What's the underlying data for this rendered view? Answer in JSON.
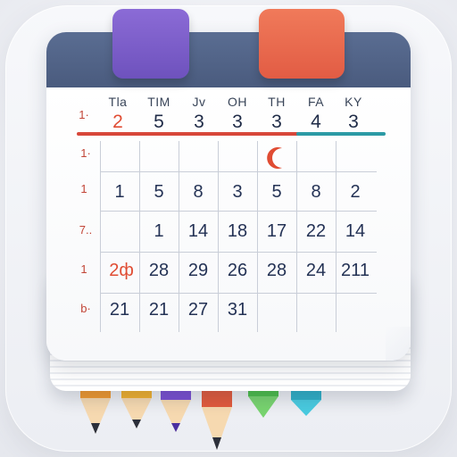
{
  "calendar": {
    "colors": {
      "header": "#4a5b7e",
      "tab_left": "#7a5bc8",
      "tab_right": "#e8674c",
      "accent_red": "#e04c33",
      "accent_teal": "#2c9aa5"
    },
    "weekday_labels": [
      "Tla",
      "TIM",
      "Jv",
      "OH",
      "TH",
      "FA",
      "KY"
    ],
    "top_dates": [
      "2",
      "5",
      "3",
      "3",
      "3",
      "4",
      "3"
    ],
    "row_labels": [
      "1·",
      "1·",
      "1",
      "7..",
      "1",
      "b·"
    ],
    "rows": [
      [
        "",
        "",
        "",
        "",
        "",
        "",
        ""
      ],
      [
        "1",
        "5",
        "8",
        "3",
        "5",
        "8",
        "2"
      ],
      [
        "",
        "1",
        "14",
        "18",
        "17",
        "22",
        "14"
      ],
      [
        "2ф",
        "28",
        "29",
        "26",
        "28",
        "24",
        "211"
      ],
      [
        "21",
        "21",
        "27",
        "31",
        "",
        "",
        ""
      ]
    ]
  },
  "pencil_colors": [
    "#f29a2e",
    "#f2b12e",
    "#7a4fd2",
    "#e25a3c",
    "#4cbf4a",
    "#2fb0c8"
  ]
}
